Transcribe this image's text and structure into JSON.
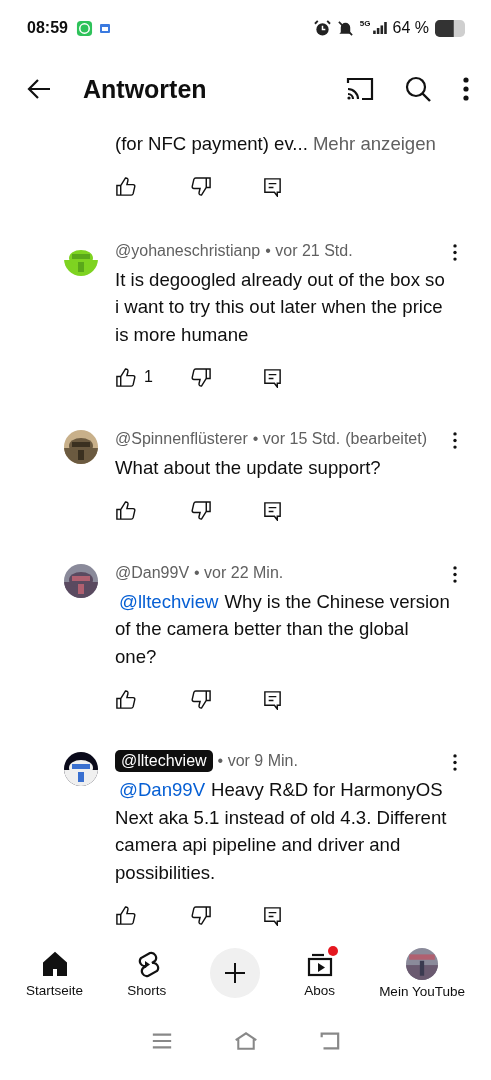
{
  "status_bar": {
    "time": "08:59",
    "network": "5G",
    "battery": "64 %"
  },
  "header": {
    "title": "Antworten"
  },
  "comments": [
    {
      "text": "(for NFC payment) ev...",
      "more": "Mehr anzeigen"
    },
    {
      "author": "@yohaneschristianp",
      "time": "• vor 21 Std.",
      "creator": false,
      "text": "It is degoogled already out of the box so i want to try this out later when the price is more humane",
      "likes": "1"
    },
    {
      "author": "@Spinnenflüsterer",
      "time": "• vor 15 Std.",
      "edited": "(bearbeitet)",
      "creator": false,
      "text": "What about the update support?"
    },
    {
      "author": "@Dan99V",
      "time": "• vor 22 Min.",
      "creator": false,
      "mention": "@lltechview",
      "text": "Why is the Chinese version of the camera better than the global one?"
    },
    {
      "author": "@lltechview",
      "time": "• vor 9 Min.",
      "creator": true,
      "mention": "@Dan99V",
      "text": "Heavy R&D for HarmonyOS Next aka 5.1 instead of old 4.3. Different camera api pipeline and driver and possibilities."
    }
  ],
  "bottom_nav": [
    {
      "kind": "tab",
      "label": "Startseite",
      "badge": false
    },
    {
      "kind": "tab",
      "label": "Shorts",
      "badge": false
    },
    {
      "kind": "create"
    },
    {
      "kind": "tab",
      "label": "Abos",
      "badge": true
    },
    {
      "kind": "avatar",
      "label": "Mein YouTube"
    }
  ]
}
